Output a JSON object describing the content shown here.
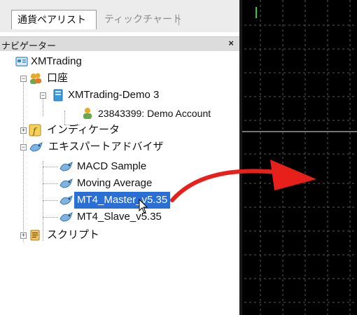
{
  "tabs": {
    "currency_pairs": "通貨ペアリスト",
    "tick_chart": "ティックチャート"
  },
  "navigator": {
    "title": "ナビゲーター",
    "close": "×"
  },
  "tree": {
    "broker": "XMTrading",
    "accounts_folder": "口座",
    "server": "XMTrading-Demo 3",
    "account": "23843399: Demo Account",
    "indicators": "インディケータ",
    "experts": "エキスパートアドバイザ",
    "expert_items": [
      "MACD Sample",
      "Moving Average",
      "MT4_Master_v5.35",
      "MT4_Slave_v5.35"
    ],
    "scripts": "スクリプト"
  },
  "colors": {
    "selection": "#2a6fd6",
    "arrow": "#e8201c",
    "chart_bg": "#000000",
    "grid": "#5a5a5a"
  }
}
